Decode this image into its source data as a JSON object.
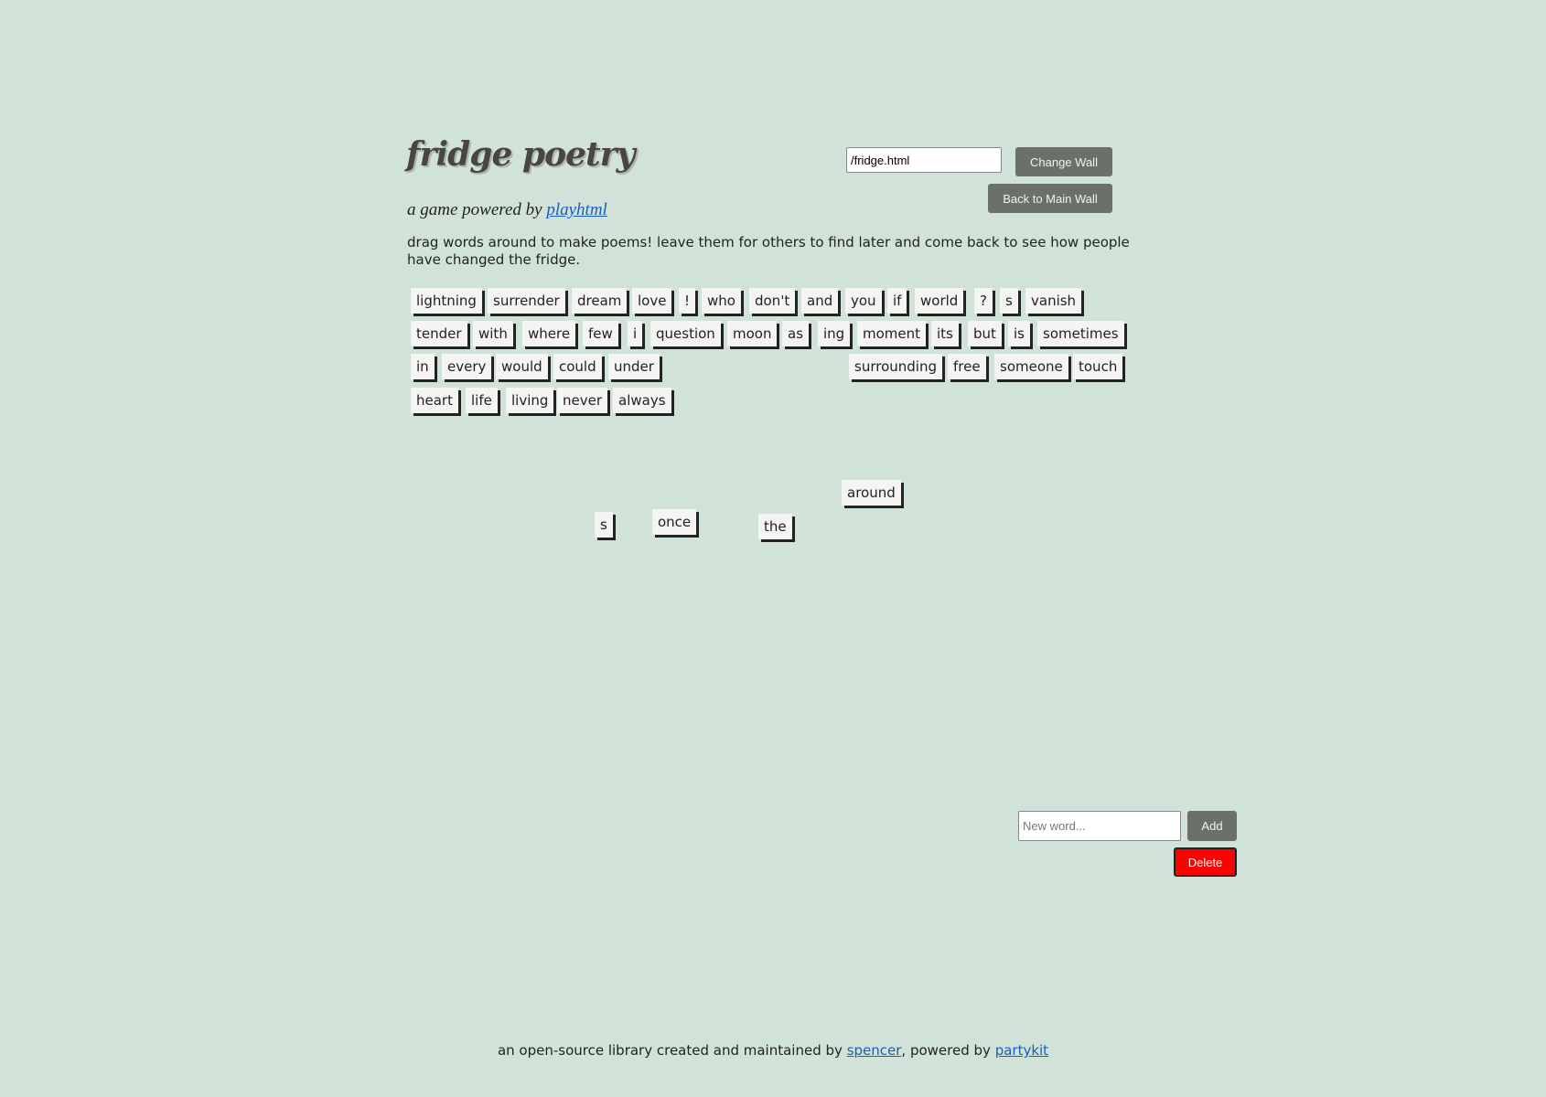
{
  "header": {
    "title": "fridge poetry",
    "subtitle_prefix": "a game powered by",
    "subtitle_link": "playhtml",
    "description": "drag words around to make poems! leave them for others to find later and come back to see how people have changed the fridge."
  },
  "wall": {
    "path_value": "/fridge.html",
    "change_label": "Change Wall",
    "back_label": "Back to Main Wall"
  },
  "words": [
    "lightning",
    "surrender",
    "dream",
    "love",
    "!",
    "who",
    "don't",
    "and",
    "you",
    "if",
    "world",
    "?",
    "s",
    "vanish",
    "tender",
    "with",
    "where",
    "few",
    "i",
    "question",
    "moon",
    "as",
    "ing",
    "moment",
    "its",
    "but",
    "is",
    "sometimes",
    "in",
    "every",
    "would",
    "could",
    "under",
    "surrounding",
    "free",
    "someone",
    "touch",
    "heart",
    "life",
    "living",
    "never",
    "always",
    "around",
    "s",
    "once",
    "the"
  ],
  "controls": {
    "new_word_placeholder": "New word...",
    "add_label": "Add",
    "delete_label": "Delete"
  },
  "footer": {
    "prefix": "an open-source library created and maintained by",
    "author_link": "spencer",
    "middle": ", powered by",
    "platform_link": "partykit"
  }
}
